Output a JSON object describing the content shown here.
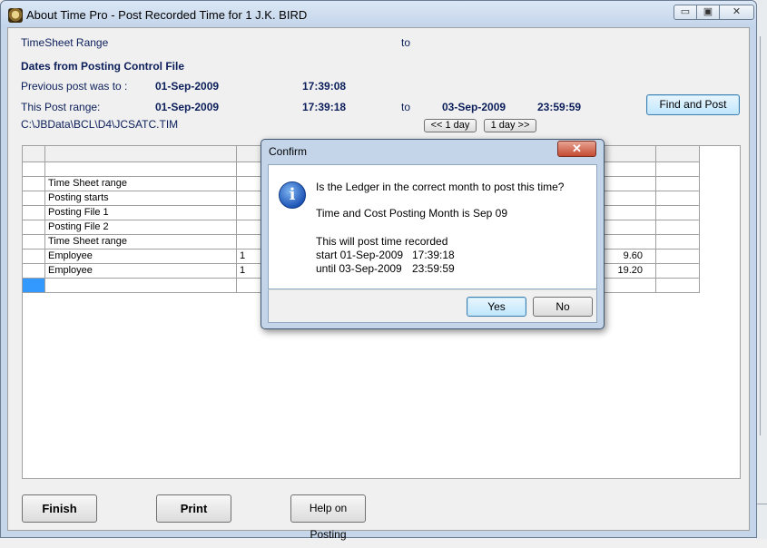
{
  "window": {
    "title": "About Time Pro - Post Recorded Time for 1 J.K. BIRD",
    "min_glyph": "▭",
    "max_glyph": "▣",
    "close_glyph": "✕"
  },
  "header": {
    "timesheet_range_label": "TimeSheet Range",
    "timesheet_to_label": "to",
    "dates_heading": "Dates from Posting Control File",
    "previous_label": "Previous post was to :",
    "previous_date": "01-Sep-2009",
    "previous_time": "17:39:08",
    "this_post_label": "This Post range:",
    "this_post_start_date": "01-Sep-2009",
    "this_post_start_time": "17:39:18",
    "this_post_to_label": "to",
    "this_post_end_date": "03-Sep-2009",
    "this_post_end_time": "23:59:59",
    "file_path": "C:\\JBData\\BCL\\D4\\JCSATC.TIM"
  },
  "buttons": {
    "find_and_post": "Find and Post",
    "prev_day": "<< 1 day",
    "next_day": "1 day >>",
    "finish": "Finish",
    "print": "Print",
    "help": "Help on Posting"
  },
  "grid": {
    "rows": [
      {
        "desc": "",
        "col2": "",
        "right": ""
      },
      {
        "desc": "Time Sheet range",
        "col2": "",
        "right": ""
      },
      {
        "desc": "Posting starts",
        "col2": "",
        "right": ""
      },
      {
        "desc": "Posting File 1",
        "col2": "",
        "right": ""
      },
      {
        "desc": "Posting File 2",
        "col2": "",
        "right": ""
      },
      {
        "desc": "Time Sheet range",
        "col2": "",
        "right": ""
      },
      {
        "desc": "Employee",
        "col2": "1",
        "right": "9.60"
      },
      {
        "desc": "Employee",
        "col2": "1",
        "right": "19.20"
      },
      {
        "desc": "",
        "col2": "",
        "right": ""
      }
    ]
  },
  "dialog": {
    "title": "Confirm",
    "close_glyph": "✕",
    "icon_glyph": "i",
    "question": "Is the Ledger in the correct month to post this time?",
    "month_line": "Time and Cost Posting Month is Sep 09",
    "will_post": "This will post time recorded",
    "start_label": "start 01-Sep-2009",
    "start_time": "17:39:18",
    "until_label": "until 03-Sep-2009",
    "until_time": "23:59:59",
    "yes": "Yes",
    "no": "No"
  },
  "colors": {
    "accent_text": "#0b1e5a",
    "selected_cell": "#3399ff",
    "dialog_close": "#c44a32"
  }
}
